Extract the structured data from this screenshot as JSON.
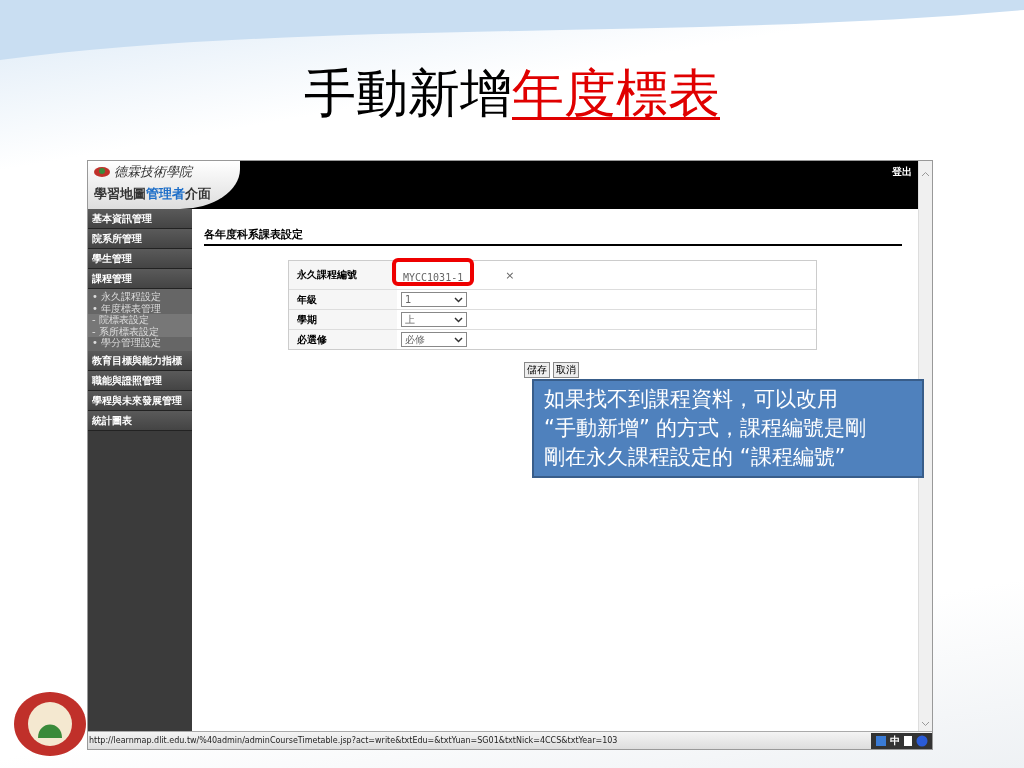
{
  "slide_title": [
    {
      "text": "手動新增",
      "highlight": false
    },
    {
      "text": "年度標表",
      "highlight": true
    }
  ],
  "header": {
    "school_name": "德霖技術學院",
    "title": [
      {
        "text": "學習地圖",
        "highlight": false
      },
      {
        "text": "管理者",
        "highlight": true
      },
      {
        "text": "介面",
        "highlight": false
      }
    ],
    "logout": "登出"
  },
  "sidebar": {
    "items": [
      {
        "label": "基本資訊管理"
      },
      {
        "label": "院系所管理"
      },
      {
        "label": "學生管理"
      },
      {
        "label": "課程管理",
        "children": [
          {
            "label": "• 永久課程設定"
          },
          {
            "label": "• 年度標表管理",
            "children": [
              {
                "label": "- 院標表設定"
              },
              {
                "label": "- 系所標表設定"
              }
            ]
          },
          {
            "label": "• 學分管理設定"
          }
        ]
      },
      {
        "label": "教育目標與能力指標"
      },
      {
        "label": "職能與證照管理"
      },
      {
        "label": "學程與未來發展管理"
      },
      {
        "label": "統計圖表"
      }
    ]
  },
  "page_heading": "各年度科系課表設定",
  "form": {
    "rows": [
      {
        "label": "永久課程編號",
        "kind": "text",
        "value": "MYCC1031-1",
        "clear": "×",
        "highlighted": true
      },
      {
        "label": "年級",
        "kind": "select",
        "value": "1",
        "highlighted": false
      },
      {
        "label": "學期",
        "kind": "select",
        "value": "上",
        "highlighted": false
      },
      {
        "label": "必選修",
        "kind": "select",
        "value": "必修",
        "highlighted": false
      }
    ],
    "buttons": [
      "儲存",
      "取消"
    ]
  },
  "callout": {
    "lines": [
      "如果找不到課程資料，可以改用",
      "“手動新增” 的方式，課程編號是剛",
      "剛在永久課程設定的 “課程編號”"
    ]
  },
  "status_bar": {
    "url": "http://learnmap.dlit.edu.tw/%40admin/adminCourseTimetable.jsp?act=write&txtEdu=&txtYuan=SG01&txtNick=4CCS&txtYear=103",
    "ime": "中"
  }
}
